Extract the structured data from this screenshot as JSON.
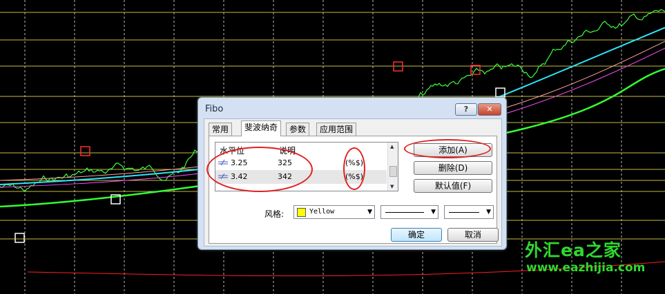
{
  "watermark": {
    "title": "外汇ea之家",
    "url": "www.eazhijia.com"
  },
  "dialog": {
    "title": "Fibo",
    "help_label": "?",
    "close_label": "✕",
    "tabs": [
      {
        "label": "常用",
        "active": false
      },
      {
        "label": "斐波纳奇",
        "active": true
      },
      {
        "label": "参数",
        "active": false
      },
      {
        "label": "应用范围",
        "active": false
      }
    ],
    "table": {
      "col_level": "水平位",
      "col_desc": "说明",
      "rows": [
        {
          "level": "3.25",
          "desc": "325",
          "fmt": "(%$)"
        },
        {
          "level": "3.42",
          "desc": "342",
          "fmt": "(%$)"
        }
      ]
    },
    "buttons": {
      "add": "添加(A)",
      "delete": "删除(D)",
      "default": "默认值(F)"
    },
    "style": {
      "label": "风格:",
      "color_name": "Yellow",
      "color_hex": "#ffff00"
    },
    "ok_label": "确定",
    "cancel_label": "取消"
  }
}
